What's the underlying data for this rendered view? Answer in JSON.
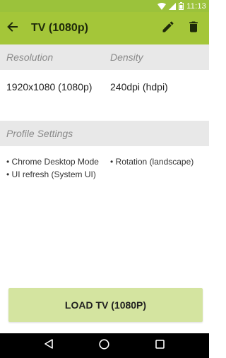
{
  "status_bar": {
    "time": "11:13"
  },
  "toolbar": {
    "title": "TV (1080p)",
    "icons": [
      "arrow-back-icon",
      "pencil-icon",
      "trash-icon"
    ]
  },
  "resolution": {
    "header_label": "Resolution",
    "value": "1920x1080 (1080p)"
  },
  "density": {
    "header_label": "Density",
    "value": "240dpi (hdpi)"
  },
  "profile_settings": {
    "header_label": "Profile Settings",
    "items": [
      "• Chrome Desktop Mode",
      "• UI refresh (System UI)",
      "• Rotation (landscape)"
    ]
  },
  "load_button": {
    "label": "LOAD TV (1080P)"
  },
  "colors": {
    "toolbar": "#a4c639",
    "status_bar": "#9bc23b",
    "button": "#d4e4a0"
  }
}
